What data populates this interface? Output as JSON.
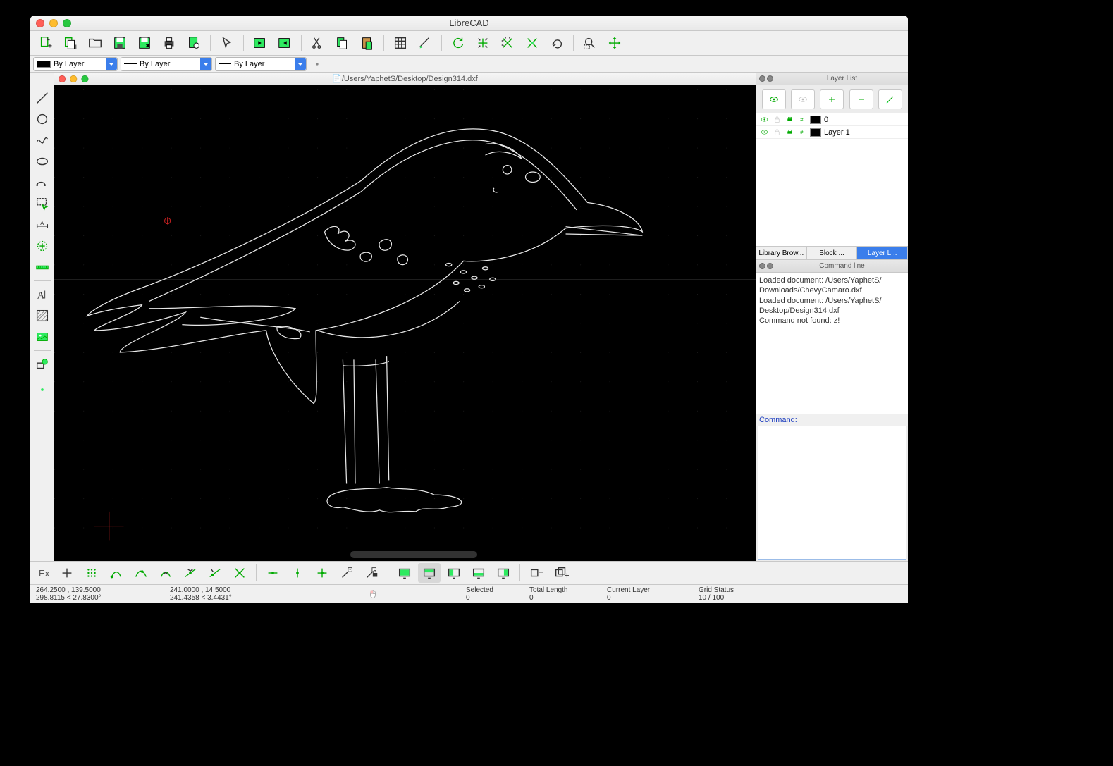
{
  "app_title": "LibreCAD",
  "document_path": "/Users/YaphetS/Desktop/Design314.dxf",
  "property_bar": {
    "color": "By Layer",
    "linewidth": "By Layer",
    "linetype": "By Layer"
  },
  "layer_panel": {
    "title": "Layer List",
    "layers": [
      {
        "name": "0"
      },
      {
        "name": "Layer 1"
      }
    ],
    "tabs": {
      "library": "Library Brow...",
      "block": "Block ...",
      "layer": "Layer L..."
    }
  },
  "command_panel": {
    "title": "Command line",
    "log": "Loaded document: /Users/YaphetS/\nDownloads/ChevyCamaro.dxf\nLoaded document: /Users/YaphetS/\nDesktop/Design314.dxf\nCommand not found: z!",
    "prompt": "Command:"
  },
  "status": {
    "coord_abs": "264.2500 , 139.5000",
    "coord_polar": "298.8115 < 27.8300°",
    "coord_rel": "241.0000 , 14.5000",
    "coord_rel_polar": "241.4358 < 3.4431°",
    "selected_label": "Selected",
    "selected_value": "0",
    "total_len_label": "Total Length",
    "total_len_value": "0",
    "current_layer_label": "Current Layer",
    "current_layer_value": "0",
    "grid_label": "Grid Status",
    "grid_value": "10 / 100"
  },
  "ex_label": "Ex"
}
